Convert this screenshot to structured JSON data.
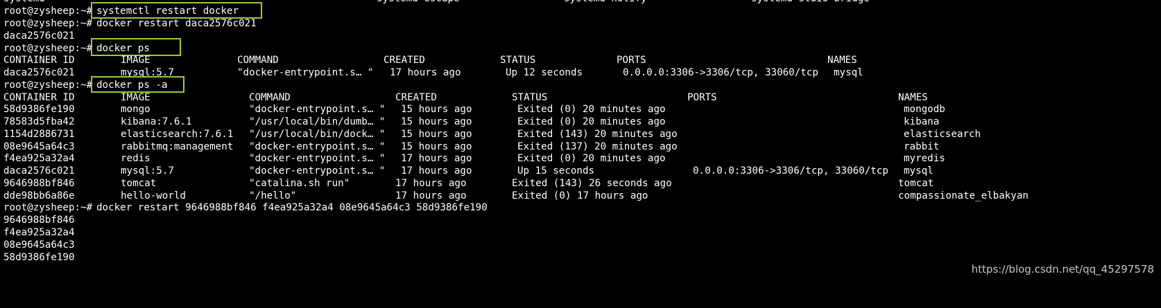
{
  "top_partial": {
    "c1": "systemd",
    "c2": "systemd-escape",
    "c3": "systemd-notify",
    "c4": "systemd-stdio-bridge"
  },
  "prompt": "root@zysheep:~#",
  "cmd1": "systemctl restart docker",
  "cmd2": "docker restart daca2576c021",
  "out2": "daca2576c021",
  "cmd3": "docker ps",
  "ps_headers": {
    "container_id": "CONTAINER ID",
    "image": "IMAGE",
    "command": "COMMAND",
    "created": "CREATED",
    "status": "STATUS",
    "ports": "PORTS",
    "names": "NAMES"
  },
  "ps_row": {
    "container_id": "daca2576c021",
    "image": "mysql:5.7",
    "command": "\"docker-entrypoint.s… \"",
    "created": "17 hours ago",
    "status": "Up 12 seconds",
    "ports": "0.0.0.0:3306->3306/tcp, 33060/tcp",
    "names": "mysql"
  },
  "cmd4": "docker ps -a",
  "psa_headers": {
    "container_id": "CONTAINER ID",
    "image": "IMAGE",
    "command": "COMMAND",
    "created": "CREATED",
    "status": "STATUS",
    "ports": "PORTS",
    "names": "NAMES"
  },
  "psa_rows": [
    {
      "container_id": "58d9386fe190",
      "image": "mongo",
      "command": "\"docker-entrypoint.s… \"",
      "created": "15 hours ago",
      "status": "Exited (0) 20 minutes ago",
      "ports": "",
      "names": "mongodb"
    },
    {
      "container_id": "78583d5fba42",
      "image": "kibana:7.6.1",
      "command": "\"/usr/local/bin/dumb… \"",
      "created": "15 hours ago",
      "status": "Exited (0) 20 minutes ago",
      "ports": "",
      "names": "kibana"
    },
    {
      "container_id": "1154d2886731",
      "image": "elasticsearch:7.6.1",
      "command": "\"/usr/local/bin/dock… \"",
      "created": "15 hours ago",
      "status": "Exited (143) 20 minutes ago",
      "ports": "",
      "names": "elasticsearch"
    },
    {
      "container_id": "08e9645a64c3",
      "image": "rabbitmq:management",
      "command": "\"docker-entrypoint.s… \"",
      "created": "15 hours ago",
      "status": "Exited (137) 20 minutes ago",
      "ports": "",
      "names": "rabbit"
    },
    {
      "container_id": "f4ea925a32a4",
      "image": "redis",
      "command": "\"docker-entrypoint.s… \"",
      "created": "17 hours ago",
      "status": "Exited (0) 20 minutes ago",
      "ports": "",
      "names": "myredis"
    },
    {
      "container_id": "daca2576c021",
      "image": "mysql:5.7",
      "command": "\"docker-entrypoint.s… \"",
      "created": "17 hours ago",
      "status": "Up 15 seconds",
      "ports": "0.0.0.0:3306->3306/tcp, 33060/tcp",
      "names": "mysql"
    },
    {
      "container_id": "9646988bf846",
      "image": "tomcat",
      "command": "\"catalina.sh run\"",
      "created": "17 hours ago",
      "status": "Exited (143) 26 seconds ago",
      "ports": "",
      "names": "tomcat"
    },
    {
      "container_id": "dde98bb6a86e",
      "image": "hello-world",
      "command": "\"/hello\"",
      "created": "17 hours ago",
      "status": "Exited (0) 17 hours ago",
      "ports": "",
      "names": "compassionate_elbakyan"
    }
  ],
  "cmd5": "docker restart 9646988bf846 f4ea925a32a4 08e9645a64c3 58d9386fe190",
  "out5": [
    "9646988bf846",
    "f4ea925a32a4",
    "08e9645a64c3",
    "58d9386fe190"
  ],
  "watermark": "https://blog.csdn.net/qq_45297578",
  "colors": {
    "background": "#000000",
    "text": "#ffffff",
    "highlight": "#9acd32",
    "watermark": "#c8c8c8"
  }
}
